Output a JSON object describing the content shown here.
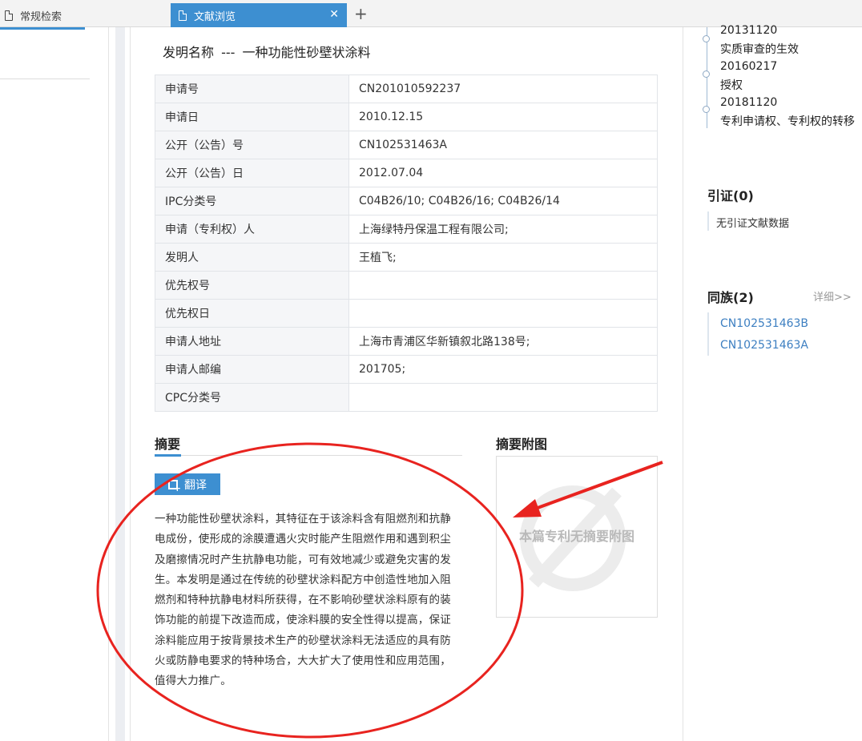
{
  "tabs": [
    {
      "label": "常规检索",
      "active": false
    },
    {
      "label": "文献浏览",
      "active": true
    }
  ],
  "document": {
    "title_label": "发明名称",
    "title_sep": "---",
    "title_value": "一种功能性砂壁状涂料",
    "fields": [
      {
        "key": "申请号",
        "value": "CN201010592237"
      },
      {
        "key": "申请日",
        "value": "2010.12.15"
      },
      {
        "key": "公开（公告）号",
        "value": "CN102531463A"
      },
      {
        "key": "公开（公告）日",
        "value": "2012.07.04"
      },
      {
        "key": "IPC分类号",
        "value": "C04B26/10; C04B26/16; C04B26/14"
      },
      {
        "key": "申请（专利权）人",
        "value": "上海绿特丹保温工程有限公司;"
      },
      {
        "key": "发明人",
        "value": "王植飞;"
      },
      {
        "key": "优先权号",
        "value": ""
      },
      {
        "key": "优先权日",
        "value": ""
      },
      {
        "key": "申请人地址",
        "value": "上海市青浦区华新镇叙北路138号;"
      },
      {
        "key": "申请人邮编",
        "value": "201705;"
      },
      {
        "key": "CPC分类号",
        "value": ""
      }
    ]
  },
  "abstract": {
    "title": "摘要",
    "translate_label": "翻译",
    "lines": [
      "一种功能性砂壁状涂料，其特征在于该涂料含有阻燃剂和抗静",
      "电成份，使形成的涂膜遭遇火灾时能产生阻燃作用和遇到积尘",
      "及磨擦情况时产生抗静电功能，可有效地减少或避免灾害的发",
      "生。本发明是通过在传统的砂壁状涂料配方中创造性地加入阻",
      "燃剂和特种抗静电材料所获得，在不影响砂壁状涂料原有的装",
      "饰功能的前提下改造而成，使涂料膜的安全性得以提高，保证",
      "涂料能应用于按背景技术生产的砂壁状涂料无法适应的具有防",
      "火或防静电要求的特种场合，大大扩大了使用性和应用范围，",
      "值得大力推广。"
    ]
  },
  "figure": {
    "title": "摘要附图",
    "placeholder": "本篇专利无摘要附图"
  },
  "timeline": [
    {
      "date": "20131120",
      "event": "实质审查的生效"
    },
    {
      "date": "20160217",
      "event": "授权"
    },
    {
      "date": "20181120",
      "event": "专利申请权、专利权的转移"
    }
  ],
  "citations": {
    "title": "引证(0)",
    "empty_text": "无引证文献数据"
  },
  "family": {
    "title": "同族(2)",
    "more_label": "详细>>",
    "items": [
      "CN102531463B",
      "CN102531463A"
    ]
  },
  "colors": {
    "accent": "#3d8fd1",
    "annotation": "#e8231f"
  }
}
